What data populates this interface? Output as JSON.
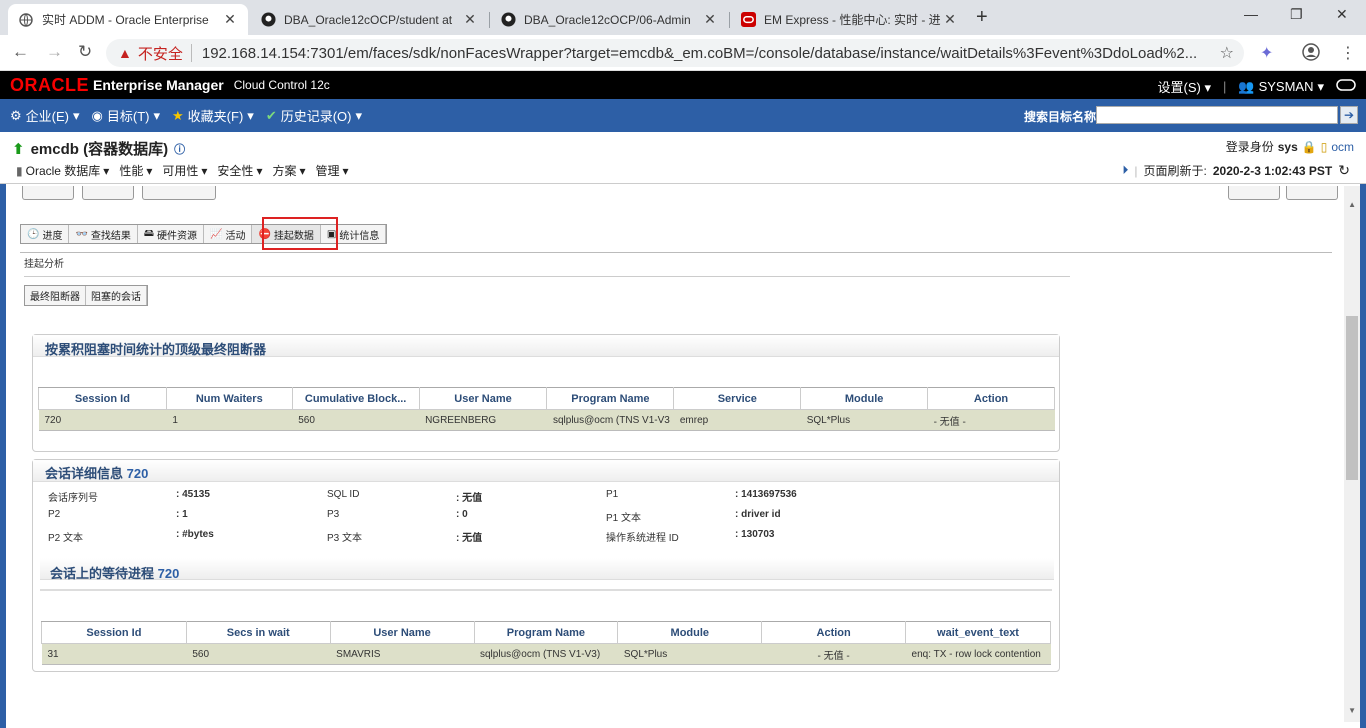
{
  "browser": {
    "tabs": [
      {
        "title": "实时 ADDM - Oracle Enterprise",
        "active": true
      },
      {
        "title": "DBA_Oracle12cOCP/student at"
      },
      {
        "title": "DBA_Oracle12cOCP/06-Admin"
      },
      {
        "title": "EM Express - 性能中心: 实时 - 进"
      }
    ],
    "insecure_label": "不安全",
    "url": "192.168.14.154:7301/em/faces/sdk/nonFacesWrapper?target=emcdb&_em.coBM=/console/database/instance/waitDetails%3Fevent%3DdoLoad%2..."
  },
  "oem": {
    "brand": "ORACLE",
    "product": "Enterprise Manager",
    "edition": "Cloud Control 12c",
    "settings": "设置(S)",
    "user": "SYSMAN"
  },
  "menubar": {
    "items": [
      "企业(E)",
      "目标(T)",
      "收藏夹(F)",
      "历史记录(O)"
    ],
    "search_label": "搜索目标名称"
  },
  "target": {
    "title": "emcdb (容器数据库)",
    "login_label": "登录身份",
    "login_user": "sys",
    "host": "ocm",
    "menu": [
      "Oracle 数据库",
      "性能",
      "可用性",
      "安全性",
      "方案",
      "管理"
    ],
    "refresh_label": "页面刷新于:",
    "refresh_time": "2020-2-3 1:02:43 PST"
  },
  "toolbar": {
    "buttons": [
      "进度",
      "查找结果",
      "硬件资源",
      "活动",
      "挂起数据",
      "统计信息"
    ]
  },
  "hang": {
    "section_label": "挂起分析",
    "subtabs": [
      "最终阻断器",
      "阻塞的会话"
    ]
  },
  "blockers": {
    "title": "按累积阻塞时间统计的顶级最终阻断器",
    "columns": [
      "Session Id",
      "Num Waiters",
      "Cumulative Block...",
      "User Name",
      "Program Name",
      "Service",
      "Module",
      "Action"
    ],
    "rows": [
      [
        "720",
        "1",
        "560",
        "NGREENBERG",
        "sqlplus@ocm (TNS V1-V3",
        "emrep",
        "SQL*Plus",
        "- 无值 -"
      ]
    ]
  },
  "session": {
    "title": "会话详细信息",
    "id": "720",
    "fields": [
      {
        "label": "会话序列号",
        "value": ": 45135"
      },
      {
        "label": "SQL ID",
        "value": ":  无值"
      },
      {
        "label": "P1",
        "value": ": 1413697536"
      },
      {
        "label": "P2",
        "value": ": 1"
      },
      {
        "label": "P3",
        "value": ": 0"
      },
      {
        "label": "P1 文本",
        "value": ": driver id"
      },
      {
        "label": "P2 文本",
        "value": ": #bytes"
      },
      {
        "label": "P3 文本",
        "value": ":  无值"
      },
      {
        "label": "操作系统进程 ID",
        "value": ": 130703"
      }
    ]
  },
  "waiters": {
    "title": "会话上的等待进程",
    "id": "720",
    "columns": [
      "Session Id",
      "Secs in wait",
      "User Name",
      "Program Name",
      "Module",
      "Action",
      "wait_event_text"
    ],
    "rows": [
      [
        "31",
        "560",
        "SMAVRIS",
        "sqlplus@ocm (TNS V1-V3)",
        "SQL*Plus",
        "- 无值 -",
        "enq: TX - row lock contention"
      ]
    ]
  }
}
